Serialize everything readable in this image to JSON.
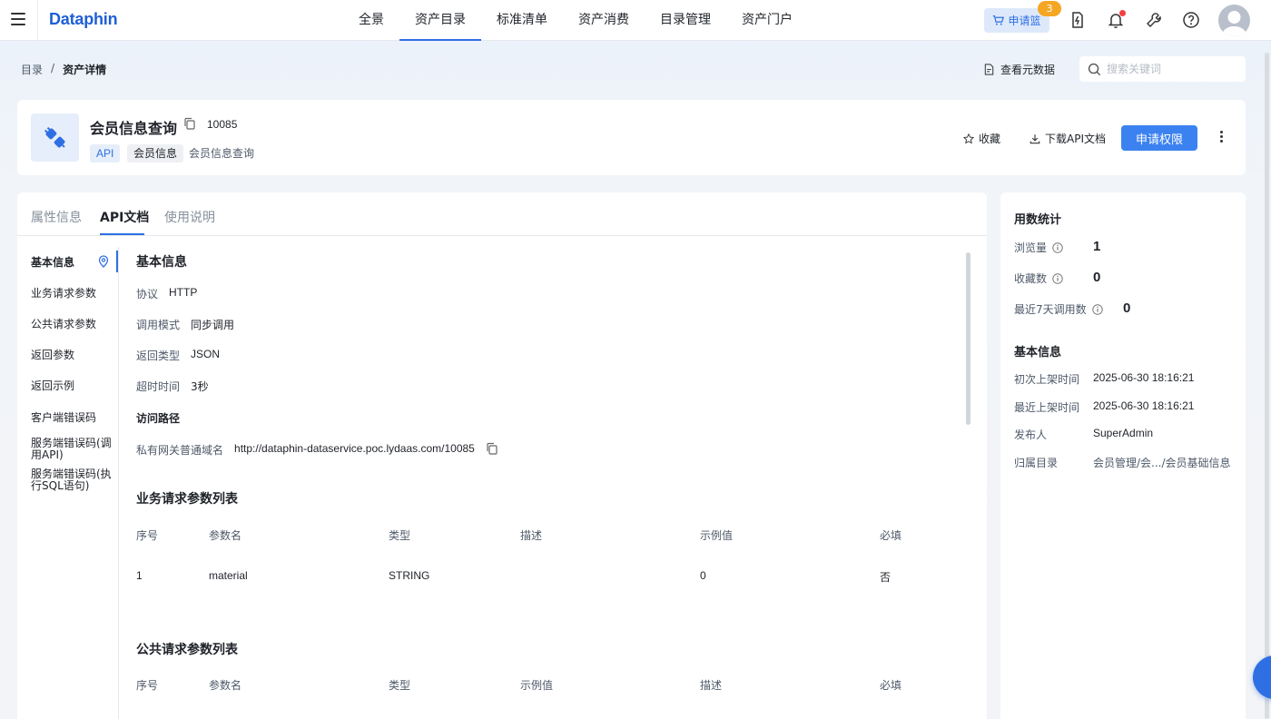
{
  "app": {
    "logo": "Dataphin"
  },
  "nav": {
    "items": [
      {
        "label": "全景"
      },
      {
        "label": "资产目录",
        "active": true
      },
      {
        "label": "标准清单"
      },
      {
        "label": "资产消费"
      },
      {
        "label": "目录管理"
      },
      {
        "label": "资产门户"
      }
    ],
    "cart_label": "申请篮",
    "cart_count": "3"
  },
  "breadcrumb": {
    "root": "目录",
    "sep": "/",
    "current": "资产详情"
  },
  "toolbar": {
    "meta_label": "查看元数据",
    "search_placeholder": "搜索关键词"
  },
  "asset": {
    "name": "会员信息查询",
    "id": "10085",
    "tags": {
      "type": "API",
      "category": "会员信息",
      "desc": "会员信息查询"
    },
    "actions": {
      "favorite": "收藏",
      "download": "下载API文档",
      "apply": "申请权限"
    }
  },
  "tabs": [
    {
      "label": "属性信息"
    },
    {
      "label": "API文档",
      "active": true
    },
    {
      "label": "使用说明"
    }
  ],
  "side_nav": [
    "基本信息",
    "业务请求参数",
    "公共请求参数",
    "返回参数",
    "返回示例",
    "客户端错误码",
    "服务端错误码(调用API)",
    "服务端错误码(执行SQL语句)"
  ],
  "basic": {
    "title": "基本信息",
    "protocol": {
      "k": "协议",
      "v": "HTTP"
    },
    "mode": {
      "k": "调用模式",
      "v": "同步调用"
    },
    "return_type": {
      "k": "返回类型",
      "v": "JSON"
    },
    "timeout": {
      "k": "超时时间",
      "v": "3秒"
    },
    "path_title": "访问路径",
    "domain": {
      "k": "私有网关普通域名",
      "v": "http://dataphin-dataservice.poc.lydaas.com/10085"
    }
  },
  "biz_params": {
    "title": "业务请求参数列表",
    "headers": [
      "序号",
      "参数名",
      "类型",
      "描述",
      "示例值",
      "必填"
    ],
    "rows": [
      [
        "1",
        "material",
        "STRING",
        "",
        "0",
        "否"
      ]
    ]
  },
  "common_params": {
    "title": "公共请求参数列表",
    "headers": [
      "序号",
      "参数名",
      "类型",
      "示例值",
      "描述",
      "必填"
    ]
  },
  "usage": {
    "title": "用数统计",
    "views": {
      "label": "浏览量",
      "value": "1"
    },
    "favorites": {
      "label": "收藏数",
      "value": "0"
    },
    "calls7d": {
      "label": "最近7天调用数",
      "value": "0"
    }
  },
  "info": {
    "title": "基本信息",
    "first_publish": {
      "label": "初次上架时间",
      "value": "2025-06-30 18:16:21"
    },
    "last_publish": {
      "label": "最近上架时间",
      "value": "2025-06-30 18:16:21"
    },
    "publisher": {
      "label": "发布人",
      "value": "SuperAdmin"
    },
    "directory": {
      "label": "归属目录",
      "value": "会员管理/会.../会员基础信息"
    }
  },
  "colors": {
    "accent": "#2f6fe4",
    "primary_button": "#3b82f0",
    "badge": "#f5a623",
    "alert_dot": "#f53f3f"
  }
}
